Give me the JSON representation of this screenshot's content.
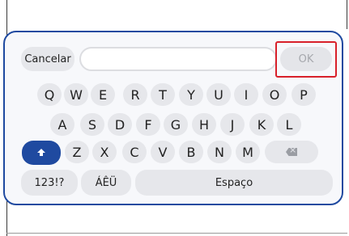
{
  "top_bar": {
    "cancel_label": "Cancelar",
    "text_value": "",
    "ok_label": "OK"
  },
  "keys": {
    "row1": [
      "Q",
      "W",
      "E",
      "R",
      "T",
      "Y",
      "U",
      "I",
      "O",
      "P"
    ],
    "row2": [
      "A",
      "S",
      "D",
      "F",
      "G",
      "H",
      "J",
      "K",
      "L"
    ],
    "row3": [
      "Z",
      "X",
      "C",
      "V",
      "B",
      "N",
      "M"
    ],
    "numeric_label": "123!?",
    "accents_label": "ÁÊÜ",
    "space_label": "Espaço"
  },
  "icons": {
    "shift": "shift-arrow-icon",
    "backspace": "backspace-icon"
  },
  "colors": {
    "accent": "#1f4aa0",
    "highlight": "#d8202a"
  }
}
